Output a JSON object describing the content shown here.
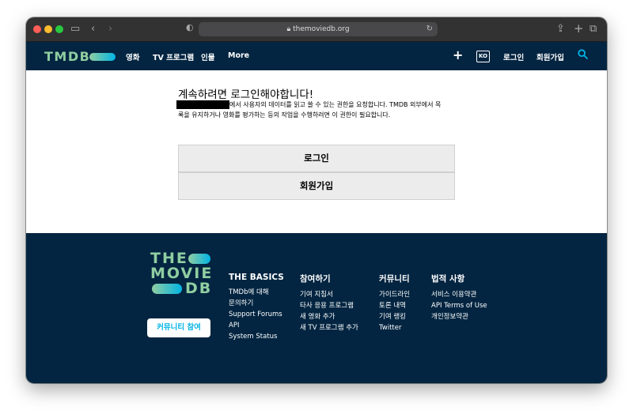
{
  "browser": {
    "url": "themoviedb.org"
  },
  "nav": {
    "logo": "TMDB",
    "items": [
      "영화",
      "TV 프로그램",
      "인물",
      "More"
    ],
    "add_icon": "plus-icon",
    "lang": "KO",
    "login": "로그인",
    "signup": "회원가입",
    "search_icon": "search-icon"
  },
  "main": {
    "heading": "계속하려면 로그인해야합니다!",
    "desc_line1": "에서 사용자의 데이터를 읽고 쓸 수 있는 권한을 요청합니다. TMDB 외부에서 목",
    "desc_line2": "록을 유지하거나 영화를 평가하는 등의 작업을 수행하려면 이 권한이 필요합니다.",
    "login_button": "로그인",
    "signup_button": "회원가입"
  },
  "footer": {
    "logo_lines": [
      "THE",
      "MOVIE",
      "DB"
    ],
    "community_button": "커뮤니티 참여",
    "columns": [
      {
        "title": "THE BASICS",
        "links": [
          "TMDb에 대해",
          "문의하기",
          "Support Forums",
          "API",
          "System Status"
        ]
      },
      {
        "title": "참여하기",
        "links": [
          "기여 지침서",
          "타사 응용 프로그램",
          "새 영화 추가",
          "새 TV 프로그램 추가"
        ]
      },
      {
        "title": "커뮤니티",
        "links": [
          "가이드라인",
          "토론 내역",
          "기여 랭킹",
          "Twitter"
        ]
      },
      {
        "title": "법적 사항",
        "links": [
          "서비스 이용약관",
          "API Terms of Use",
          "개인정보약관"
        ]
      }
    ]
  },
  "colors": {
    "navy": "#032541",
    "green": "#90cea1",
    "blue": "#01b4e4"
  }
}
